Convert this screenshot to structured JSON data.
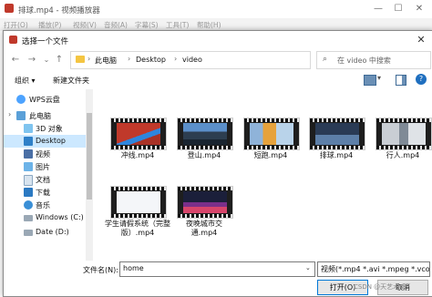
{
  "player": {
    "title": "排球.mp4 - 视频播放器",
    "menu": [
      "打开(O)",
      "播放(P)",
      "视频(V)",
      "音频(A)",
      "字幕(S)",
      "工具(T)",
      "帮助(H)"
    ]
  },
  "dialog": {
    "title": "选择一个文件",
    "breadcrumb": [
      "此电脑",
      "Desktop",
      "video"
    ],
    "search_placeholder": "在 video 中搜索",
    "toolbar": {
      "organize": "组织 ▾",
      "new_folder": "新建文件夹"
    },
    "sidebar": [
      {
        "label": "WPS云盘",
        "icon": "cloud-icon"
      },
      {
        "label": "此电脑",
        "icon": "computer-icon"
      },
      {
        "label": "3D 对象",
        "icon": "cube-icon"
      },
      {
        "label": "Desktop",
        "icon": "desktop-icon",
        "selected": true
      },
      {
        "label": "视频",
        "icon": "video-folder-icon"
      },
      {
        "label": "图片",
        "icon": "pictures-icon"
      },
      {
        "label": "文档",
        "icon": "documents-icon"
      },
      {
        "label": "下载",
        "icon": "download-icon"
      },
      {
        "label": "音乐",
        "icon": "music-icon"
      },
      {
        "label": "Windows (C:)",
        "icon": "drive-icon"
      },
      {
        "label": "Date (D:)",
        "icon": "drive-icon"
      }
    ],
    "files": [
      {
        "name": "冲线.mp4"
      },
      {
        "name": "登山.mp4"
      },
      {
        "name": "短跑.mp4"
      },
      {
        "name": "排球.mp4"
      },
      {
        "name": "行人.mp4"
      },
      {
        "name": "学生请假系统（完整版）.mp4"
      },
      {
        "name": "夜晚城市交通.mp4"
      }
    ],
    "filename_label": "文件名(N):",
    "filename_value": "home",
    "filetype_value": "视频(*.mp4 *.avi *.mpeg *.vco",
    "open_button": "打开(O)",
    "cancel_button": "取消"
  },
  "watermark": "CSDN @天艺术痴",
  "colors": {
    "selection": "#cce8ff",
    "accent": "#0078d7",
    "folder": "#f4c542"
  }
}
